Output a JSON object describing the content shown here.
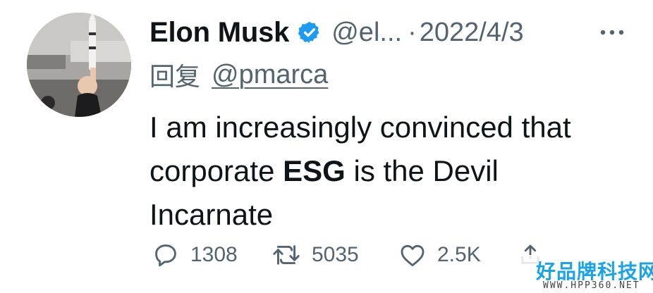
{
  "tweet": {
    "author_name": "Elon Musk",
    "handle": "@el...",
    "separator": "·",
    "date": "2022/4/3",
    "reply_label": "回复",
    "reply_to": "@pmarca",
    "text_line1": "I am increasingly convinced that",
    "text_line2_start": "corporate",
    "text_line2_bold": "ESG",
    "text_line2_end": "is the Devil",
    "text_line3": "Incarnate"
  },
  "actions": {
    "replies": "1308",
    "retweets": "5035",
    "likes": "2.5K"
  },
  "icons": {
    "verified": "verified-badge-icon",
    "more": "more-options-icon",
    "reply": "reply-icon",
    "retweet": "retweet-icon",
    "like": "heart-icon",
    "share": "share-icon"
  },
  "colors": {
    "text": "#0f1419",
    "secondary": "#536471",
    "verified_blue": "#1d9bf0",
    "watermark_blue": "#1aa3e6"
  },
  "watermark": {
    "title": "好品牌科技网",
    "url": "WWW.HPP360.NET"
  }
}
